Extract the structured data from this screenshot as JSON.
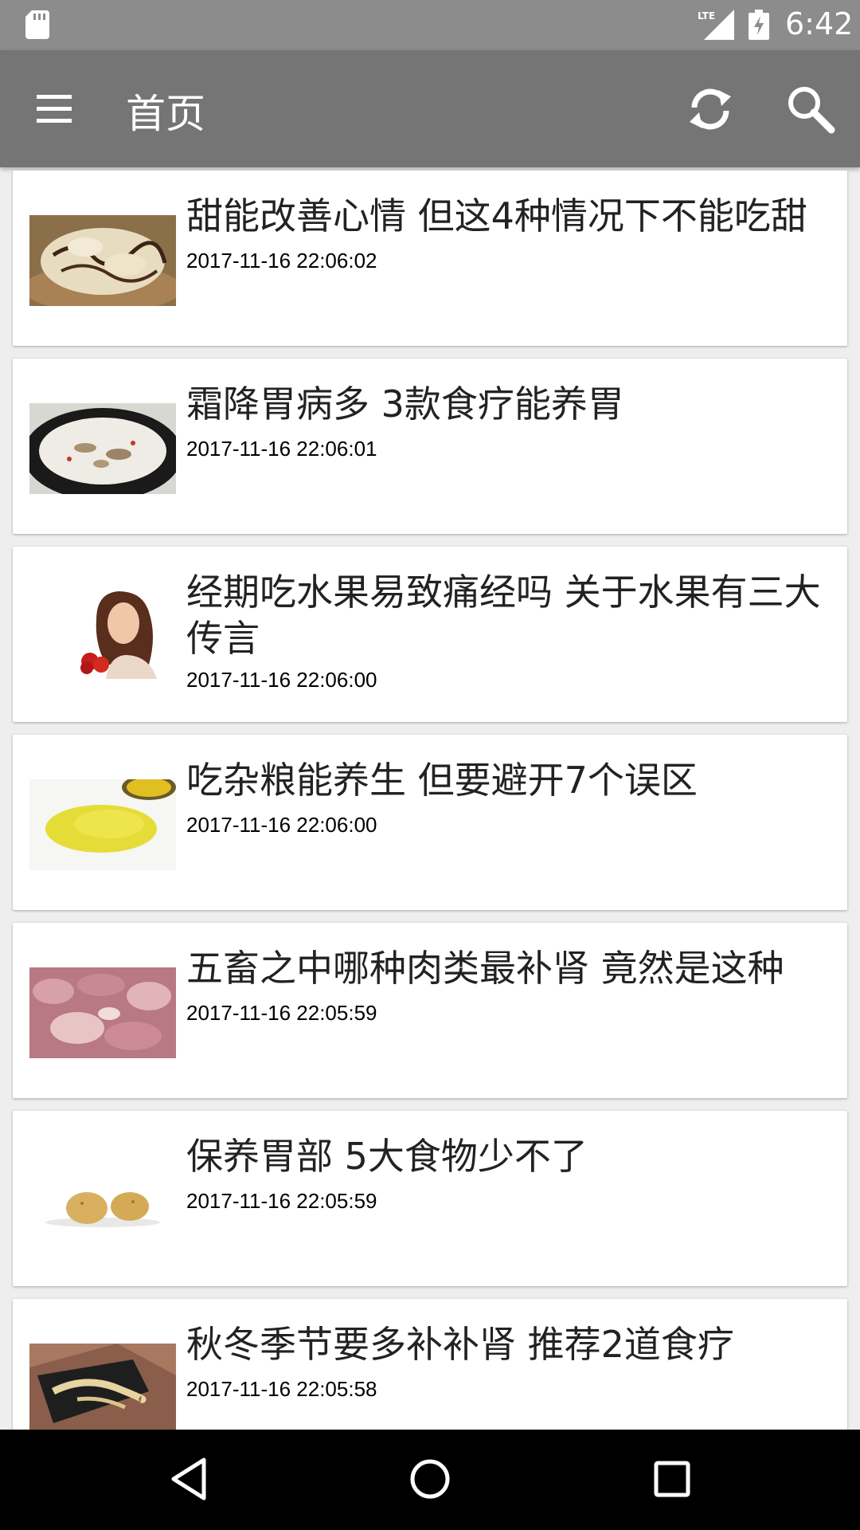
{
  "status_bar": {
    "time": "6:42",
    "icons": [
      "sd-card-icon",
      "lte-signal-icon",
      "battery-charging-icon"
    ]
  },
  "app_bar": {
    "title": "首页",
    "icons": [
      "menu-icon",
      "refresh-icon",
      "search-icon"
    ]
  },
  "articles": [
    {
      "title": "甜能改善心情 但这4种情况下不能吃甜",
      "time": "2017-11-16 22:06:02",
      "image": "ice-cream-dessert"
    },
    {
      "title": "霜降胃病多 3款食疗能养胃",
      "time": "2017-11-16 22:06:01",
      "image": "soup-pot"
    },
    {
      "title": "经期吃水果易致痛经吗 关于水果有三大传言",
      "time": "2017-11-16 22:06:00",
      "image": "woman-with-fruit"
    },
    {
      "title": "吃杂粮能养生 但要避开7个误区",
      "time": "2017-11-16 22:06:00",
      "image": "millet-grain"
    },
    {
      "title": "五畜之中哪种肉类最补肾 竟然是这种",
      "time": "2017-11-16 22:05:59",
      "image": "raw-meat"
    },
    {
      "title": "保养胃部 5大食物少不了",
      "time": "2017-11-16 22:05:59",
      "image": "potatoes"
    },
    {
      "title": "秋冬季节要多补补肾 推荐2道食疗",
      "time": "2017-11-16 22:05:58",
      "image": "ginseng-root"
    }
  ],
  "nav_bar": {
    "icons": [
      "back-icon",
      "home-icon",
      "recents-icon"
    ]
  }
}
